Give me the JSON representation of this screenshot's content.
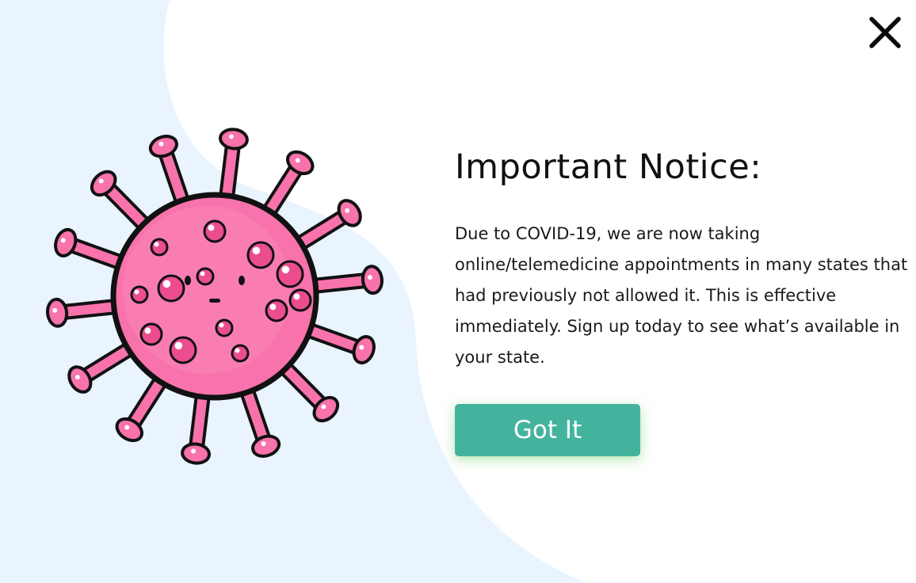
{
  "notice": {
    "title": "Important Notice:",
    "body": "Due to COVID-19, we are now taking online/telemedicine appointments in many states that had previously not allowed it. This is effective immediately. Sign up today to see what’s available in your state.",
    "button_label": "Got It"
  },
  "icons": {
    "close": "close-icon",
    "illustration": "virus-illustration"
  },
  "colors": {
    "background": "#ffffff",
    "blob": "#e9f4ff",
    "button": "#44b39d",
    "button_text": "#ffffff",
    "virus_body": "#f872ab",
    "virus_outline": "#111111",
    "text": "#111111"
  }
}
